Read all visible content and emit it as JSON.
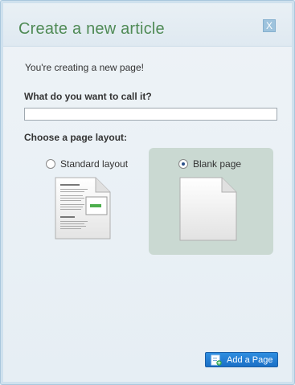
{
  "dialog": {
    "title": "Create a new article",
    "close_label": "X",
    "intro": "You're creating a new page!",
    "name_question": "What do you want to call it?",
    "name_value": "",
    "layout_question": "Choose a page layout:",
    "layouts": [
      {
        "label": "Standard layout",
        "selected": false
      },
      {
        "label": "Blank page",
        "selected": true
      }
    ],
    "add_button_label": "Add a Page"
  },
  "colors": {
    "title": "#4f8a55",
    "selected_layout_bg": "#cad9d2",
    "button": "#1f7bd1",
    "border": "#a9c7dd"
  }
}
